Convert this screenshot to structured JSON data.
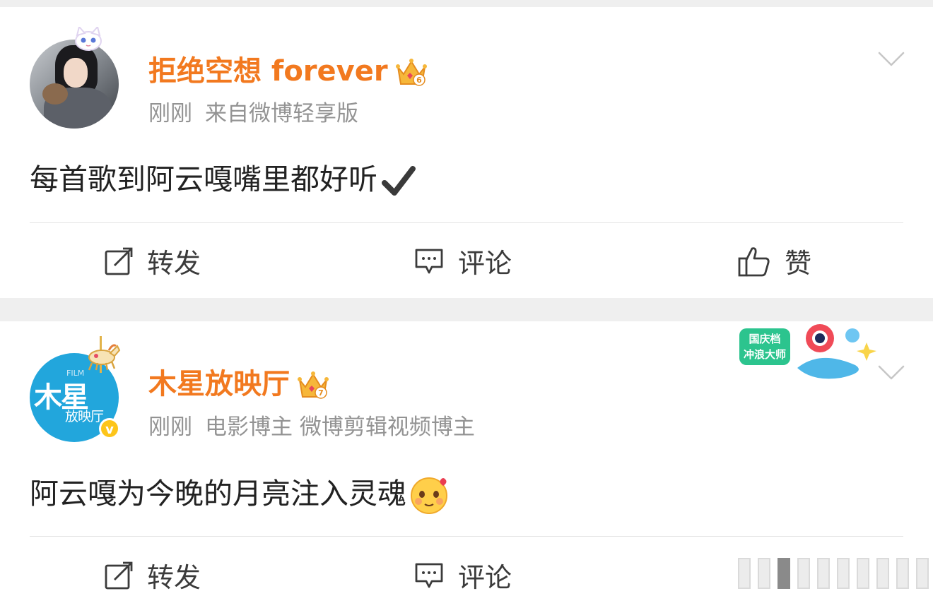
{
  "posts": [
    {
      "author": "拒绝空想 forever",
      "level_badge": "6",
      "time": "刚刚",
      "source": "来自微博轻享版",
      "content": "每首歌到阿云嘎嘴里都好听",
      "content_icon": "check-mark-icon",
      "actions": {
        "repost": "转发",
        "comment": "评论",
        "like": "赞"
      }
    },
    {
      "author": "木星放映厅",
      "level_badge": "7",
      "time": "刚刚",
      "tags": "电影博主 微博剪辑视频博主",
      "content": "阿云嘎为今晚的月亮注入灵魂",
      "content_icon": "blushing-emoji-icon",
      "avatar_logo": {
        "film": "FILM",
        "big": "木星",
        "small": "放映厅",
        "verified": "v"
      },
      "sticker": {
        "line1": "国庆档",
        "line2": "冲浪大师"
      },
      "actions": {
        "repost": "转发",
        "comment": "评论"
      }
    }
  ],
  "colors": {
    "author": "#f2791f",
    "meta": "#939393",
    "text": "#222222",
    "background": "#efefef",
    "card": "#ffffff"
  }
}
